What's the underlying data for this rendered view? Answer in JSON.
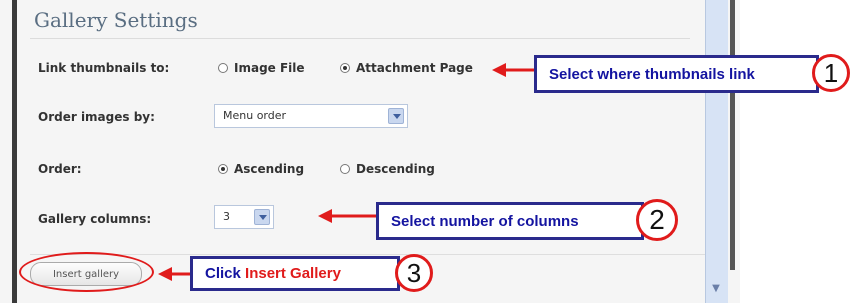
{
  "panel": {
    "title": "Gallery Settings"
  },
  "settings": {
    "link_thumbnails": {
      "label": "Link thumbnails to:",
      "options": [
        "Image File",
        "Attachment Page"
      ],
      "selected": "Attachment Page"
    },
    "order_images_by": {
      "label": "Order images by:",
      "value": "Menu order"
    },
    "order": {
      "label": "Order:",
      "options": [
        "Ascending",
        "Descending"
      ],
      "selected": "Ascending"
    },
    "gallery_columns": {
      "label": "Gallery columns:",
      "value": "3"
    }
  },
  "insert_button": {
    "label": "Insert gallery"
  },
  "annotations": {
    "callout1": {
      "text": "Select where thumbnails link",
      "number": "1"
    },
    "callout2": {
      "text": "Select number of columns",
      "number": "2"
    },
    "callout3": {
      "text_prefix": "Click ",
      "text_highlight": "Insert Gallery",
      "number": "3"
    },
    "colors": {
      "callout_border": "#2a2a8c",
      "callout_text": "#1414a0",
      "arrow": "#e01b1b"
    }
  }
}
